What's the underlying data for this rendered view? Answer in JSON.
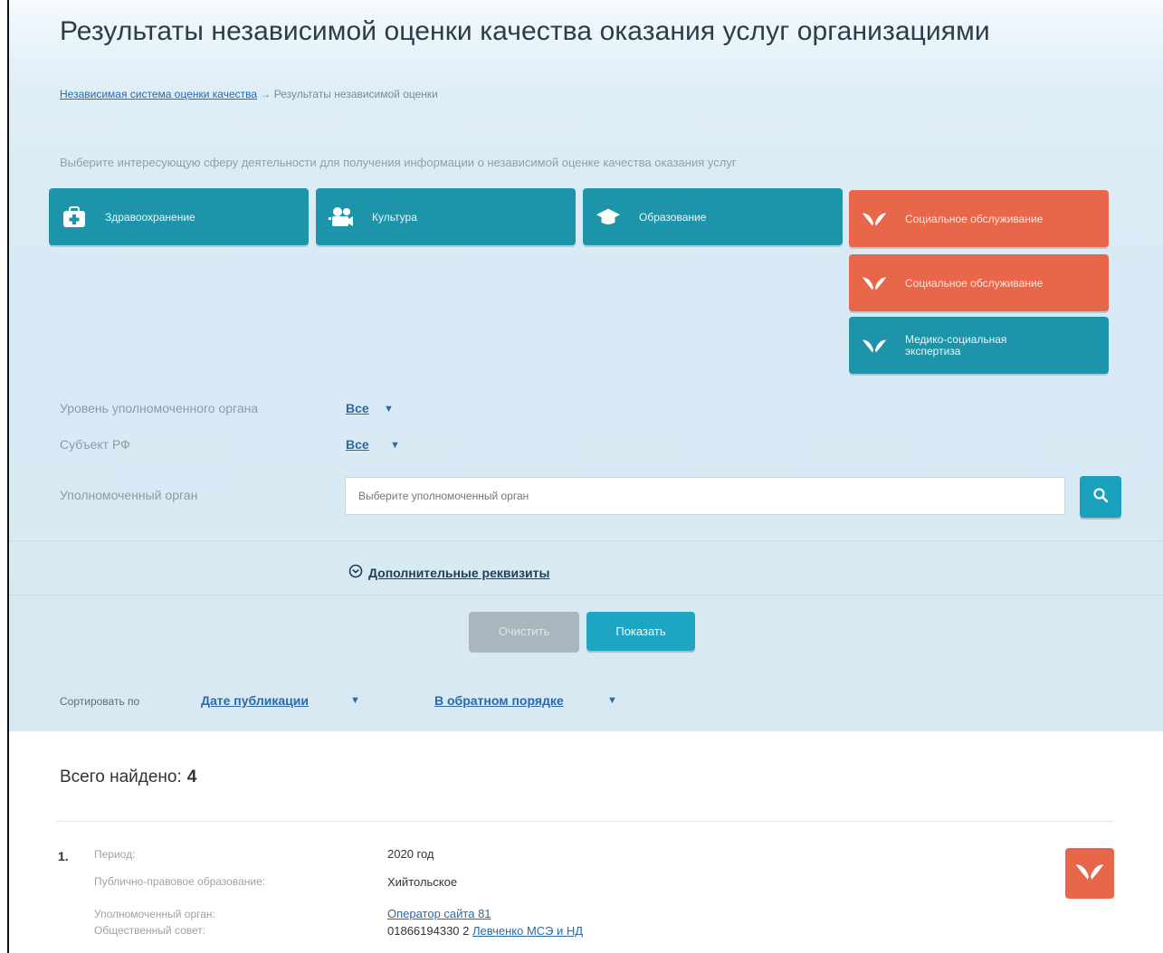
{
  "header": {
    "title": "Результаты независимой оценки качества оказания услуг организациями",
    "breadcrumb_link": "Независимая система оценки качества",
    "breadcrumb_sep": "→",
    "breadcrumb_current": "Результаты независимой оценки"
  },
  "hint": "Выберите интересующую сферу деятельности для получения информации о независимой оценке качества оказания услуг",
  "categories": [
    {
      "label": "Здравоохранение",
      "icon": "medkit-icon",
      "color": "#1d94a9"
    },
    {
      "label": "Культура",
      "icon": "camera-icon",
      "color": "#1d94a9"
    },
    {
      "label": "Образование",
      "icon": "graduation-cap-icon",
      "color": "#1d94a9"
    },
    {
      "label": "Социальное обслуживание",
      "icon": "wings-icon",
      "color": "#e8664a"
    },
    {
      "label": "Социальное обслуживание",
      "icon": "wings-icon",
      "color": "#e8664a"
    },
    {
      "label": "Медико-социальная экспертиза",
      "icon": "wings-icon",
      "color": "#1d94a9"
    }
  ],
  "filters": {
    "level_label": "Уровень уполномоченного органа",
    "level_value": "Все",
    "region_label": "Субъект РФ",
    "region_value": "Все",
    "org_label": "Уполномоченный орган",
    "org_placeholder": "Выберите уполномоченный орган"
  },
  "extra_link": "Дополнительные реквизиты",
  "buttons": {
    "clear": "Очистить",
    "show": "Показать"
  },
  "sort": {
    "label": "Сортировать по",
    "field": "Дате публикации",
    "order": "В обратном порядке"
  },
  "results": {
    "found_label": "Всего найдено:",
    "found_count": "4",
    "items": [
      {
        "number": "1.",
        "period_label": "Период:",
        "period_value": "2020 год",
        "entity_label": "Публично-правовое образование:",
        "entity_value": "Хийтольское",
        "org_label": "Уполномоченный орган:",
        "org_value": "Оператор сайта 81",
        "council_label": "Общественный совет:",
        "council_code": "01866194330 2",
        "council_link": "Левченко МСЭ и НД"
      }
    ]
  },
  "colors": {
    "accent": "#1d94a9",
    "orange": "#e8664a",
    "link": "#2a6aa8"
  }
}
